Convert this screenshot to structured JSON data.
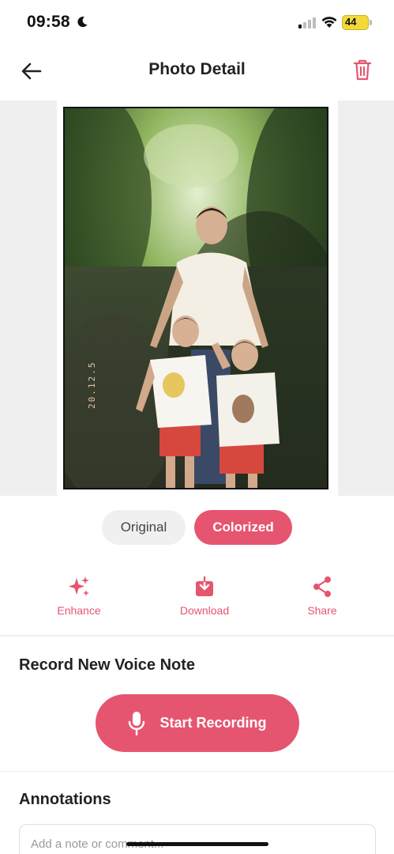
{
  "status_bar": {
    "time": "09:58",
    "battery": "44"
  },
  "header": {
    "title": "Photo Detail"
  },
  "photo": {
    "date_stamp": "20.12.5"
  },
  "toggle": {
    "original_label": "Original",
    "colorized_label": "Colorized",
    "selected": "Colorized"
  },
  "actions": {
    "enhance_label": "Enhance",
    "download_label": "Download",
    "share_label": "Share"
  },
  "voice_note": {
    "title": "Record New Voice Note",
    "button_label": "Start Recording"
  },
  "annotations": {
    "title": "Annotations",
    "placeholder": "Add a note or comment..."
  },
  "colors": {
    "accent": "#e6556f",
    "toggle_inactive": "#f0f0f0"
  }
}
